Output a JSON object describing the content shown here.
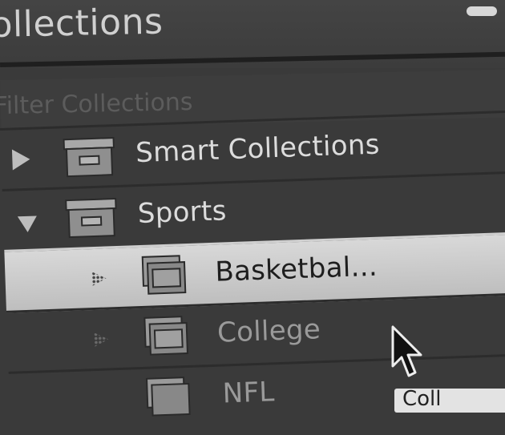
{
  "panel": {
    "title": "ollections",
    "filter_placeholder": "Filter Collections"
  },
  "tree": [
    {
      "label": "Smart Collections",
      "icon": "collection-set-icon",
      "disclosure": "collapsed"
    },
    {
      "label": "Sports",
      "icon": "collection-set-icon",
      "disclosure": "expanded"
    },
    {
      "label": "Basketbal...",
      "icon": "collection-icon",
      "selected": true
    },
    {
      "label": "College",
      "icon": "collection-icon"
    },
    {
      "label": "NFL",
      "icon": "collection-icon"
    }
  ],
  "corner_tag": {
    "text": "Coll"
  },
  "colors": {
    "panel_bg": "#3a3a3a",
    "selected_row": "#cfcfcf",
    "text": "#dcdcdc"
  }
}
